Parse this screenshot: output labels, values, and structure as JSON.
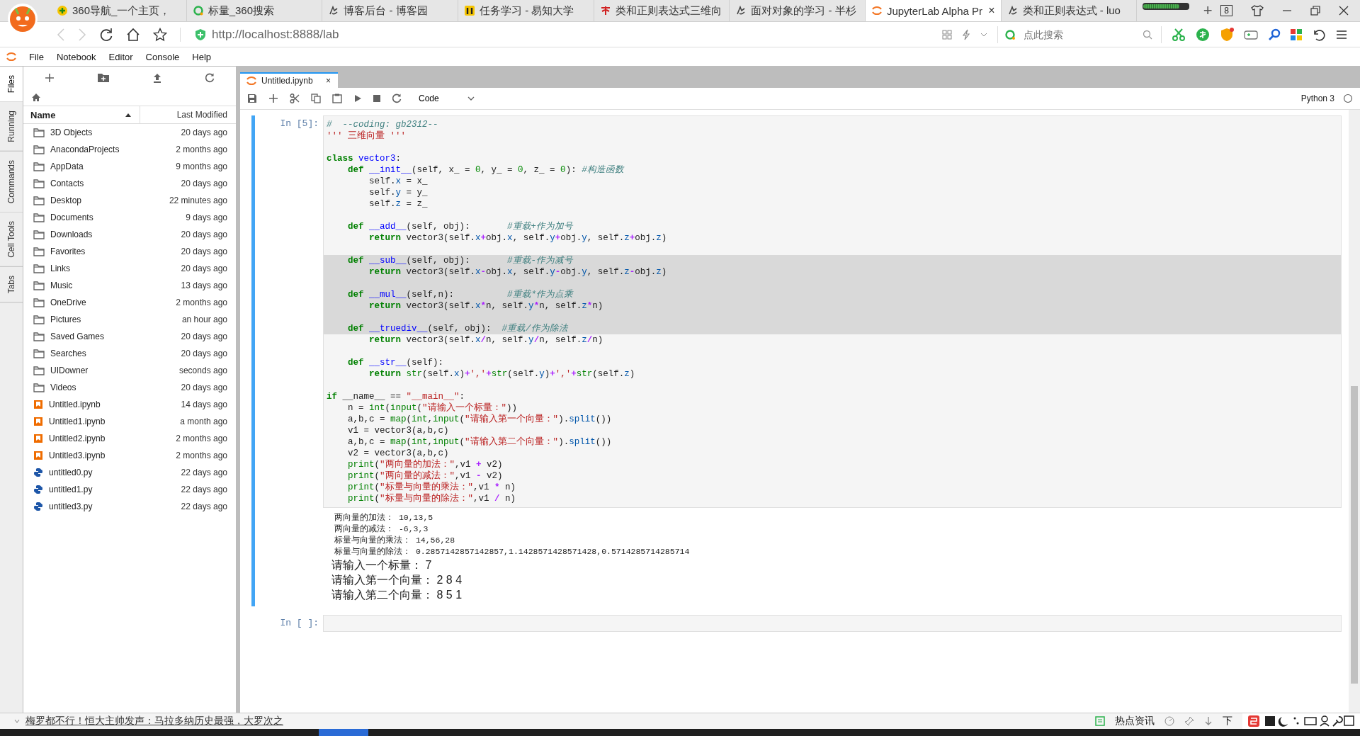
{
  "browser": {
    "tabs": [
      {
        "label": "360导航_一个主页，",
        "selected": false
      },
      {
        "label": "标量_360搜索",
        "selected": false
      },
      {
        "label": "博客后台 - 博客园",
        "selected": false
      },
      {
        "label": "任务学习 - 易知大学",
        "selected": false
      },
      {
        "label": "类和正则表达式三维向",
        "selected": false
      },
      {
        "label": "面对对象的学习 - 半杉",
        "selected": false
      },
      {
        "label": "JupyterLab Alpha Pr",
        "selected": true,
        "close": "×"
      },
      {
        "label": "类和正则表达式 - luo",
        "selected": false
      }
    ],
    "new_tab": "+",
    "tab_count": "8",
    "address": "http://localhost:8888/lab",
    "search": {
      "placeholder": "点此搜索"
    }
  },
  "menu": [
    "File",
    "Notebook",
    "Editor",
    "Console",
    "Help"
  ],
  "side_tabs": [
    {
      "label": "Files",
      "selected": true
    },
    {
      "label": "Running",
      "selected": false
    },
    {
      "label": "Commands",
      "selected": false
    },
    {
      "label": "Cell Tools",
      "selected": false
    },
    {
      "label": "Tabs",
      "selected": false
    }
  ],
  "file_browser": {
    "columns": [
      {
        "label": "Name",
        "sorted": true
      },
      {
        "label": "Last Modified",
        "sorted": false
      }
    ],
    "items": [
      {
        "name": "3D Objects",
        "modified": "20 days ago",
        "kind": "folder"
      },
      {
        "name": "AnacondaProjects",
        "modified": "2 months ago",
        "kind": "folder"
      },
      {
        "name": "AppData",
        "modified": "9 months ago",
        "kind": "folder"
      },
      {
        "name": "Contacts",
        "modified": "20 days ago",
        "kind": "folder"
      },
      {
        "name": "Desktop",
        "modified": "22 minutes ago",
        "kind": "folder"
      },
      {
        "name": "Documents",
        "modified": "9 days ago",
        "kind": "folder"
      },
      {
        "name": "Downloads",
        "modified": "20 days ago",
        "kind": "folder"
      },
      {
        "name": "Favorites",
        "modified": "20 days ago",
        "kind": "folder"
      },
      {
        "name": "Links",
        "modified": "20 days ago",
        "kind": "folder"
      },
      {
        "name": "Music",
        "modified": "13 days ago",
        "kind": "folder"
      },
      {
        "name": "OneDrive",
        "modified": "2 months ago",
        "kind": "folder"
      },
      {
        "name": "Pictures",
        "modified": "an hour ago",
        "kind": "folder"
      },
      {
        "name": "Saved Games",
        "modified": "20 days ago",
        "kind": "folder"
      },
      {
        "name": "Searches",
        "modified": "20 days ago",
        "kind": "folder"
      },
      {
        "name": "UIDowner",
        "modified": "seconds ago",
        "kind": "folder"
      },
      {
        "name": "Videos",
        "modified": "20 days ago",
        "kind": "folder"
      },
      {
        "name": "Untitled.ipynb",
        "modified": "14 days ago",
        "kind": "notebook"
      },
      {
        "name": "Untitled1.ipynb",
        "modified": "a month ago",
        "kind": "notebook"
      },
      {
        "name": "Untitled2.ipynb",
        "modified": "2 months ago",
        "kind": "notebook"
      },
      {
        "name": "Untitled3.ipynb",
        "modified": "2 months ago",
        "kind": "notebook"
      },
      {
        "name": "untitled0.py",
        "modified": "22 days ago",
        "kind": "python"
      },
      {
        "name": "untitled1.py",
        "modified": "22 days ago",
        "kind": "python"
      },
      {
        "name": "untitled3.py",
        "modified": "22 days ago",
        "kind": "python"
      }
    ]
  },
  "notebook": {
    "tab": {
      "label": "Untitled.ipynb",
      "close": "×"
    },
    "cell_type": "Code",
    "kernel": "Python 3",
    "cells": [
      {
        "prompt": "In [5]:",
        "active": true,
        "lines": [
          {
            "selected": false,
            "tokens": [
              {
                "text": "#  --coding: gb2312--",
                "kind": "comment"
              }
            ]
          },
          {
            "selected": false,
            "tokens": [
              {
                "text": "''' 三维向量 '''",
                "kind": "string"
              }
            ]
          },
          {
            "selected": false
          },
          {
            "selected": false,
            "tokens": [
              {
                "text": "class",
                "kind": "keyword"
              },
              {
                "text": " vector3",
                "kind": "defname"
              },
              {
                "text": ":",
                "kind": "plain"
              }
            ]
          },
          {
            "selected": false,
            "tokens": [
              {
                "text": "    def",
                "kind": "keyword"
              },
              {
                "text": " __init__",
                "kind": "defname"
              },
              {
                "text": "(self, x_ = ",
                "kind": "plain"
              },
              {
                "text": "0",
                "kind": "number"
              },
              {
                "text": ", y_ = ",
                "kind": "plain"
              },
              {
                "text": "0",
                "kind": "number"
              },
              {
                "text": ", z_ = ",
                "kind": "plain"
              },
              {
                "text": "0",
                "kind": "number"
              },
              {
                "text": "): ",
                "kind": "plain"
              },
              {
                "text": "#构造函数",
                "kind": "comment"
              }
            ]
          },
          {
            "selected": false,
            "tokens": [
              {
                "text": "        self.",
                "kind": "plain"
              },
              {
                "text": "x",
                "kind": "attr"
              },
              {
                "text": " = x_",
                "kind": "plain"
              }
            ]
          },
          {
            "selected": false,
            "tokens": [
              {
                "text": "        self.",
                "kind": "plain"
              },
              {
                "text": "y",
                "kind": "attr"
              },
              {
                "text": " = y_",
                "kind": "plain"
              }
            ]
          },
          {
            "selected": false,
            "tokens": [
              {
                "text": "        self.",
                "kind": "plain"
              },
              {
                "text": "z",
                "kind": "attr"
              },
              {
                "text": " = z_",
                "kind": "plain"
              }
            ]
          },
          {
            "selected": false
          },
          {
            "selected": false,
            "tokens": [
              {
                "text": "    def",
                "kind": "keyword"
              },
              {
                "text": " __add__",
                "kind": "defname"
              },
              {
                "text": "(self, obj):       ",
                "kind": "plain"
              },
              {
                "text": "#重载+作为加号",
                "kind": "comment"
              }
            ]
          },
          {
            "selected": false,
            "tokens": [
              {
                "text": "        return",
                "kind": "keyword"
              },
              {
                "text": " vector3(self.",
                "kind": "plain"
              },
              {
                "text": "x",
                "kind": "attr"
              },
              {
                "text": "+",
                "kind": "operator"
              },
              {
                "text": "obj.",
                "kind": "plain"
              },
              {
                "text": "x",
                "kind": "attr"
              },
              {
                "text": ", self.",
                "kind": "plain"
              },
              {
                "text": "y",
                "kind": "attr"
              },
              {
                "text": "+",
                "kind": "operator"
              },
              {
                "text": "obj.",
                "kind": "plain"
              },
              {
                "text": "y",
                "kind": "attr"
              },
              {
                "text": ", self.",
                "kind": "plain"
              },
              {
                "text": "z",
                "kind": "attr"
              },
              {
                "text": "+",
                "kind": "operator"
              },
              {
                "text": "obj.",
                "kind": "plain"
              },
              {
                "text": "z",
                "kind": "attr"
              },
              {
                "text": ")",
                "kind": "plain"
              }
            ]
          },
          {
            "selected": false
          },
          {
            "selected": true,
            "tokens": [
              {
                "text": "    def",
                "kind": "keyword"
              },
              {
                "text": " __sub__",
                "kind": "defname"
              },
              {
                "text": "(self, obj):       ",
                "kind": "plain"
              },
              {
                "text": "#重载-作为减号",
                "kind": "comment"
              }
            ]
          },
          {
            "selected": true,
            "tokens": [
              {
                "text": "        return",
                "kind": "keyword"
              },
              {
                "text": " vector3(self.",
                "kind": "plain"
              },
              {
                "text": "x",
                "kind": "attr"
              },
              {
                "text": "-",
                "kind": "operator"
              },
              {
                "text": "obj.",
                "kind": "plain"
              },
              {
                "text": "x",
                "kind": "attr"
              },
              {
                "text": ", self.",
                "kind": "plain"
              },
              {
                "text": "y",
                "kind": "attr"
              },
              {
                "text": "-",
                "kind": "operator"
              },
              {
                "text": "obj.",
                "kind": "plain"
              },
              {
                "text": "y",
                "kind": "attr"
              },
              {
                "text": ", self.",
                "kind": "plain"
              },
              {
                "text": "z",
                "kind": "attr"
              },
              {
                "text": "-",
                "kind": "operator"
              },
              {
                "text": "obj.",
                "kind": "plain"
              },
              {
                "text": "z",
                "kind": "attr"
              },
              {
                "text": ")",
                "kind": "plain"
              }
            ]
          },
          {
            "selected": true
          },
          {
            "selected": true,
            "tokens": [
              {
                "text": "    def",
                "kind": "keyword"
              },
              {
                "text": " __mul__",
                "kind": "defname"
              },
              {
                "text": "(self,n):          ",
                "kind": "plain"
              },
              {
                "text": "#重载*作为点乘",
                "kind": "comment"
              }
            ]
          },
          {
            "selected": true,
            "tokens": [
              {
                "text": "        return",
                "kind": "keyword"
              },
              {
                "text": " vector3(self.",
                "kind": "plain"
              },
              {
                "text": "x",
                "kind": "attr"
              },
              {
                "text": "*",
                "kind": "operator"
              },
              {
                "text": "n, self.",
                "kind": "plain"
              },
              {
                "text": "y",
                "kind": "attr"
              },
              {
                "text": "*",
                "kind": "operator"
              },
              {
                "text": "n, self.",
                "kind": "plain"
              },
              {
                "text": "z",
                "kind": "attr"
              },
              {
                "text": "*",
                "kind": "operator"
              },
              {
                "text": "n)",
                "kind": "plain"
              }
            ]
          },
          {
            "selected": true
          },
          {
            "selected": true,
            "tokens": [
              {
                "text": "    def",
                "kind": "keyword"
              },
              {
                "text": " __truediv__",
                "kind": "defname"
              },
              {
                "text": "(self, obj):  ",
                "kind": "plain"
              },
              {
                "text": "#重载/作为除法",
                "kind": "comment"
              }
            ]
          },
          {
            "selected": false,
            "tokens": [
              {
                "text": "        return",
                "kind": "keyword"
              },
              {
                "text": " vector3(self.",
                "kind": "plain"
              },
              {
                "text": "x",
                "kind": "attr"
              },
              {
                "text": "/",
                "kind": "operator"
              },
              {
                "text": "n, self.",
                "kind": "plain"
              },
              {
                "text": "y",
                "kind": "attr"
              },
              {
                "text": "/",
                "kind": "operator"
              },
              {
                "text": "n, self.",
                "kind": "plain"
              },
              {
                "text": "z",
                "kind": "attr"
              },
              {
                "text": "/",
                "kind": "operator"
              },
              {
                "text": "n)",
                "kind": "plain"
              }
            ]
          },
          {
            "selected": false
          },
          {
            "selected": false,
            "tokens": [
              {
                "text": "    def",
                "kind": "keyword"
              },
              {
                "text": " __str__",
                "kind": "defname"
              },
              {
                "text": "(self):",
                "kind": "plain"
              }
            ]
          },
          {
            "selected": false,
            "tokens": [
              {
                "text": "        return",
                "kind": "keyword"
              },
              {
                "text": " str",
                "kind": "builtin"
              },
              {
                "text": "(self.",
                "kind": "plain"
              },
              {
                "text": "x",
                "kind": "attr"
              },
              {
                "text": ")",
                "kind": "plain"
              },
              {
                "text": "+",
                "kind": "operator"
              },
              {
                "text": "','",
                "kind": "string"
              },
              {
                "text": "+",
                "kind": "operator"
              },
              {
                "text": "str",
                "kind": "builtin"
              },
              {
                "text": "(self.",
                "kind": "plain"
              },
              {
                "text": "y",
                "kind": "attr"
              },
              {
                "text": ")",
                "kind": "plain"
              },
              {
                "text": "+",
                "kind": "operator"
              },
              {
                "text": "','",
                "kind": "string"
              },
              {
                "text": "+",
                "kind": "operator"
              },
              {
                "text": "str",
                "kind": "builtin"
              },
              {
                "text": "(self.",
                "kind": "plain"
              },
              {
                "text": "z",
                "kind": "attr"
              },
              {
                "text": ")",
                "kind": "plain"
              }
            ]
          },
          {
            "selected": false
          },
          {
            "selected": false,
            "tokens": [
              {
                "text": "if",
                "kind": "keyword"
              },
              {
                "text": " __name__ == ",
                "kind": "plain"
              },
              {
                "text": "\"__main__\"",
                "kind": "string"
              },
              {
                "text": ":",
                "kind": "plain"
              }
            ]
          },
          {
            "selected": false,
            "tokens": [
              {
                "text": "    n = ",
                "kind": "plain"
              },
              {
                "text": "int",
                "kind": "builtin"
              },
              {
                "text": "(",
                "kind": "plain"
              },
              {
                "text": "input",
                "kind": "builtin"
              },
              {
                "text": "(",
                "kind": "plain"
              },
              {
                "text": "\"请输入一个标量：\"",
                "kind": "string"
              },
              {
                "text": "))",
                "kind": "plain"
              }
            ]
          },
          {
            "selected": false,
            "tokens": [
              {
                "text": "    a,b,c = ",
                "kind": "plain"
              },
              {
                "text": "map",
                "kind": "builtin"
              },
              {
                "text": "(",
                "kind": "plain"
              },
              {
                "text": "int",
                "kind": "builtin"
              },
              {
                "text": ",",
                "kind": "plain"
              },
              {
                "text": "input",
                "kind": "builtin"
              },
              {
                "text": "(",
                "kind": "plain"
              },
              {
                "text": "\"请输入第一个向量：\"",
                "kind": "string"
              },
              {
                "text": ").",
                "kind": "plain"
              },
              {
                "text": "split",
                "kind": "attr"
              },
              {
                "text": "())",
                "kind": "plain"
              }
            ]
          },
          {
            "selected": false,
            "tokens": [
              {
                "text": "    v1 = vector3(a,b,c)",
                "kind": "plain"
              }
            ]
          },
          {
            "selected": false,
            "tokens": [
              {
                "text": "    a,b,c = ",
                "kind": "plain"
              },
              {
                "text": "map",
                "kind": "builtin"
              },
              {
                "text": "(",
                "kind": "plain"
              },
              {
                "text": "int",
                "kind": "builtin"
              },
              {
                "text": ",",
                "kind": "plain"
              },
              {
                "text": "input",
                "kind": "builtin"
              },
              {
                "text": "(",
                "kind": "plain"
              },
              {
                "text": "\"请输入第二个向量：\"",
                "kind": "string"
              },
              {
                "text": ").",
                "kind": "plain"
              },
              {
                "text": "split",
                "kind": "attr"
              },
              {
                "text": "())",
                "kind": "plain"
              }
            ]
          },
          {
            "selected": false,
            "tokens": [
              {
                "text": "    v2 = vector3(a,b,c)",
                "kind": "plain"
              }
            ]
          },
          {
            "selected": false,
            "tokens": [
              {
                "text": "    print",
                "kind": "builtin"
              },
              {
                "text": "(",
                "kind": "plain"
              },
              {
                "text": "\"两向量的加法：\"",
                "kind": "string"
              },
              {
                "text": ",v1 ",
                "kind": "plain"
              },
              {
                "text": "+",
                "kind": "operator"
              },
              {
                "text": " v2)",
                "kind": "plain"
              }
            ]
          },
          {
            "selected": false,
            "tokens": [
              {
                "text": "    print",
                "kind": "builtin"
              },
              {
                "text": "(",
                "kind": "plain"
              },
              {
                "text": "\"两向量的减法：\"",
                "kind": "string"
              },
              {
                "text": ",v1 ",
                "kind": "plain"
              },
              {
                "text": "-",
                "kind": "operator"
              },
              {
                "text": " v2)",
                "kind": "plain"
              }
            ]
          },
          {
            "selected": false,
            "tokens": [
              {
                "text": "    print",
                "kind": "builtin"
              },
              {
                "text": "(",
                "kind": "plain"
              },
              {
                "text": "\"标量与向量的乘法：\"",
                "kind": "string"
              },
              {
                "text": ",v1 ",
                "kind": "plain"
              },
              {
                "text": "*",
                "kind": "operator"
              },
              {
                "text": " n)",
                "kind": "plain"
              }
            ]
          },
          {
            "selected": false,
            "tokens": [
              {
                "text": "    print",
                "kind": "builtin"
              },
              {
                "text": "(",
                "kind": "plain"
              },
              {
                "text": "\"标量与向量的除法：\"",
                "kind": "string"
              },
              {
                "text": ",v1 ",
                "kind": "plain"
              },
              {
                "text": "/",
                "kind": "operator"
              },
              {
                "text": " n)",
                "kind": "plain"
              }
            ]
          }
        ],
        "outputs": [
          {
            "text": "两向量的加法： 10,13,5",
            "kind": "stream"
          },
          {
            "text": "两向量的减法： -6,3,3",
            "kind": "stream"
          },
          {
            "text": "标量与向量的乘法： 14,56,28",
            "kind": "stream"
          },
          {
            "text": "标量与向量的除法： 0.2857142857142857,1.1428571428571428,0.5714285714285714",
            "kind": "stream"
          },
          {
            "text": "请输入一个标量： 7",
            "kind": "stdin"
          },
          {
            "text": "请输入第一个向量： 2 8 4",
            "kind": "stdin"
          },
          {
            "text": "请输入第二个向量： 8 5 1",
            "kind": "stdin"
          }
        ]
      },
      {
        "prompt": "In [ ]:",
        "active": false
      }
    ]
  },
  "status_bar": {
    "news": "梅罗都不行！恒大主帅发声：马拉多纳历史最强，大罗次之",
    "hot": "热点资讯",
    "download": "下"
  }
}
